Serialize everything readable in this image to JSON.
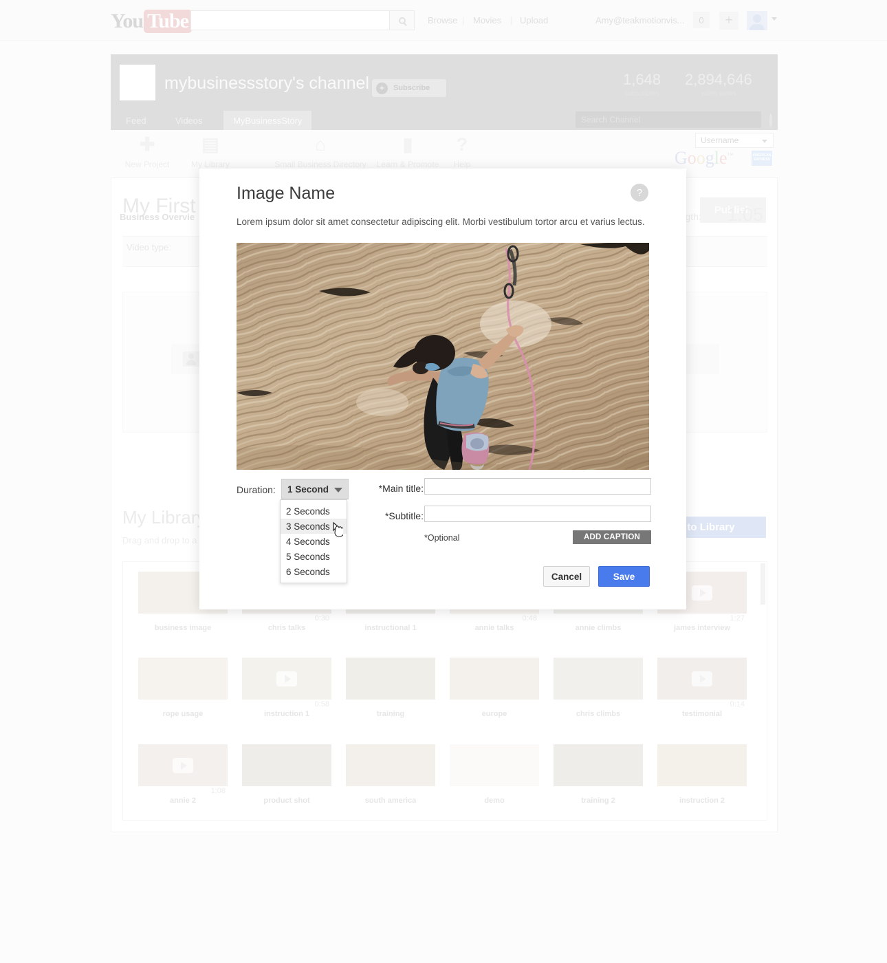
{
  "youtube_header": {
    "logo_you": "You",
    "logo_tube": "Tube",
    "search_placeholder": "",
    "search_icon": "search-icon",
    "nav": [
      "Browse",
      "Movies",
      "Upload"
    ],
    "divider": "|",
    "account": "Amy@teakmotionvis...",
    "notification_count": "0",
    "add_label": "+",
    "avatar_icon": "user-avatar-icon",
    "caret_icon": "chevron-down-icon"
  },
  "channel": {
    "title": "mybusinessstory's channel",
    "subscribe_label": "Subscribe",
    "subscribe_plus": "+",
    "subscribers_count": "1,648",
    "subscribers_label": "subscribers",
    "views_count": "2,894,646",
    "views_label": "video views",
    "tabs": [
      "Feed",
      "Videos",
      "MyBusinessStory"
    ],
    "active_tab": "MyBusinessStory",
    "search_placeholder": "Search Channel"
  },
  "app_toolbar": {
    "items": [
      {
        "label": "New Project",
        "icon": "plus-icon",
        "glyph": "✚"
      },
      {
        "label": "My Library",
        "icon": "library-icon",
        "glyph": "▤"
      },
      {
        "label": "Small Business Directory",
        "icon": "storefront-icon",
        "glyph": "⌂"
      },
      {
        "label": "Learn & Promote",
        "icon": "book-icon",
        "glyph": "▮"
      },
      {
        "label": "Help",
        "icon": "question-icon",
        "glyph": "?"
      }
    ],
    "username_label": "Username",
    "username_caret": "chevron-down-icon",
    "google_logo": [
      "G",
      "o",
      "o",
      "g",
      "l",
      "e"
    ],
    "google_tm": "™",
    "amex_line1": "AMERICAN",
    "amex_line2": "EXPRESS"
  },
  "project": {
    "title": "My First",
    "publish_label": "Publish",
    "video_type_label": "Video type:",
    "video_type_value": "Business Overvie",
    "length_label": "length:",
    "length_value": "1:05"
  },
  "library": {
    "heading": "My Library",
    "subtext": "Drag and drop to a",
    "add_button": "to Library",
    "items": [
      {
        "caption": "business image",
        "duration": "",
        "has_play": false
      },
      {
        "caption": "chris talks",
        "duration": "0:30",
        "has_play": false
      },
      {
        "caption": "instructional 1",
        "duration": "",
        "has_play": false
      },
      {
        "caption": "annie talks",
        "duration": "0:48",
        "has_play": false
      },
      {
        "caption": "annie climbs",
        "duration": "",
        "has_play": false
      },
      {
        "caption": "james interview",
        "duration": "1:27",
        "has_play": true
      },
      {
        "caption": "rope usage",
        "duration": "",
        "has_play": false
      },
      {
        "caption": "instruction 1",
        "duration": "0:58",
        "has_play": true
      },
      {
        "caption": "training",
        "duration": "",
        "has_play": false
      },
      {
        "caption": "europe",
        "duration": "",
        "has_play": false
      },
      {
        "caption": "chris climbs",
        "duration": "",
        "has_play": false
      },
      {
        "caption": "testimonial",
        "duration": "0:14",
        "has_play": true
      },
      {
        "caption": "annie 2",
        "duration": "1:08",
        "has_play": true
      },
      {
        "caption": "product shot",
        "duration": "",
        "has_play": false
      },
      {
        "caption": "south america",
        "duration": "",
        "has_play": false
      },
      {
        "caption": "demo",
        "duration": "",
        "has_play": false
      },
      {
        "caption": "training 2",
        "duration": "",
        "has_play": false
      },
      {
        "caption": "instruction 2",
        "duration": "",
        "has_play": false
      }
    ]
  },
  "modal": {
    "title": "Image Name",
    "help_icon": "question-mark-icon",
    "help_glyph": "?",
    "description": "Lorem ipsum dolor sit amet consectetur adipiscing elit. Morbi vestibulum tortor arcu et varius lectus.",
    "image_alt": "rock-climber-photo",
    "duration_label": "Duration:",
    "duration_selected": "1 Second",
    "duration_options": [
      "2 Seconds",
      "3 Seconds",
      "4 Seconds",
      "5 Seconds",
      "6 Seconds"
    ],
    "duration_highlighted": "3 Seconds",
    "main_title_label": "*Main title:",
    "main_title_value": "",
    "subtitle_label": "*Subtitle:",
    "subtitle_value": "",
    "optional_note": "*Optional",
    "add_caption_label": "ADD CAPTION",
    "cancel_label": "Cancel",
    "save_label": "Save",
    "save_color": "#4a7bec"
  }
}
